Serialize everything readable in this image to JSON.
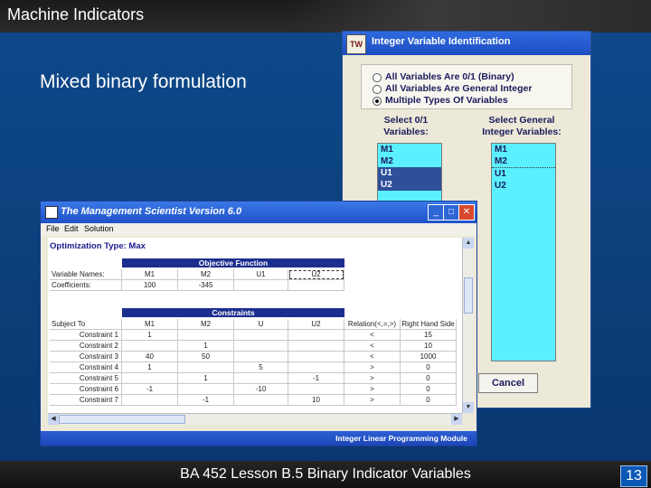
{
  "slide": {
    "title": "Machine Indicators",
    "subtitle": "Mixed binary formulation",
    "footer": "BA 452 Lesson B.5 Binary Indicator Variables",
    "slide_number": "13"
  },
  "ivi_dialog": {
    "logo_text": "TW",
    "title": "Integer Variable Identification",
    "options": [
      {
        "label": "All Variables Are 0/1 (Binary)",
        "selected": false
      },
      {
        "label": "All Variables Are General Integer",
        "selected": false
      },
      {
        "label": "Multiple Types Of Variables",
        "selected": true
      }
    ],
    "binary_header_1": "Select 0/1",
    "binary_header_2": "Variables:",
    "general_header_1": "Select General",
    "general_header_2": "Integer Variables:",
    "binary_list": [
      "M1",
      "M2",
      "U1",
      "U2"
    ],
    "general_list": [
      "M1",
      "M2",
      "U1",
      "U2"
    ],
    "cancel_label": "Cancel"
  },
  "ms_window": {
    "title": "The Management Scientist Version 6.0",
    "menu": [
      "File",
      "Edit",
      "Solution"
    ],
    "min_glyph": "_",
    "max_glyph": "□",
    "close_glyph": "✕",
    "optimization_type": "Optimization Type:  Max",
    "objective_header": "Objective Function",
    "var_names_label": "Variable Names:",
    "coefficients_label": "Coefficients:",
    "var_names": [
      "M1",
      "M2",
      "U1",
      "U2"
    ],
    "coefficients": [
      "100",
      "-345",
      "",
      ""
    ],
    "constraints_header": "Constraints",
    "constraint_columns": [
      "Subject To",
      "M1",
      "M2",
      "U",
      "U2",
      "Relation(<,=,>)",
      "Right Hand Side"
    ],
    "constraints": [
      {
        "name": "Constraint 1",
        "m1": "1",
        "m2": "",
        "u": "",
        "u2": "",
        "rel": "<",
        "rhs": "15"
      },
      {
        "name": "Constraint 2",
        "m1": "",
        "m2": "1",
        "u": "",
        "u2": "",
        "rel": "<",
        "rhs": "10"
      },
      {
        "name": "Constraint 3",
        "m1": "40",
        "m2": "50",
        "u": "",
        "u2": "",
        "rel": "<",
        "rhs": "1000"
      },
      {
        "name": "Constraint 4",
        "m1": "1",
        "m2": "",
        "u": "5",
        "u2": "",
        "rel": ">",
        "rhs": "0"
      },
      {
        "name": "Constraint 5",
        "m1": "",
        "m2": "1",
        "u": "",
        "u2": "-1",
        "rel": ">",
        "rhs": "0"
      },
      {
        "name": "Constraint 6",
        "m1": "-1",
        "m2": "",
        "u": "-10",
        "u2": "",
        "rel": ">",
        "rhs": "0"
      },
      {
        "name": "Constraint 7",
        "m1": "",
        "m2": "-1",
        "u": "",
        "u2": "10",
        "rel": ">",
        "rhs": "0"
      }
    ],
    "status": "Integer Linear Programming Module"
  }
}
